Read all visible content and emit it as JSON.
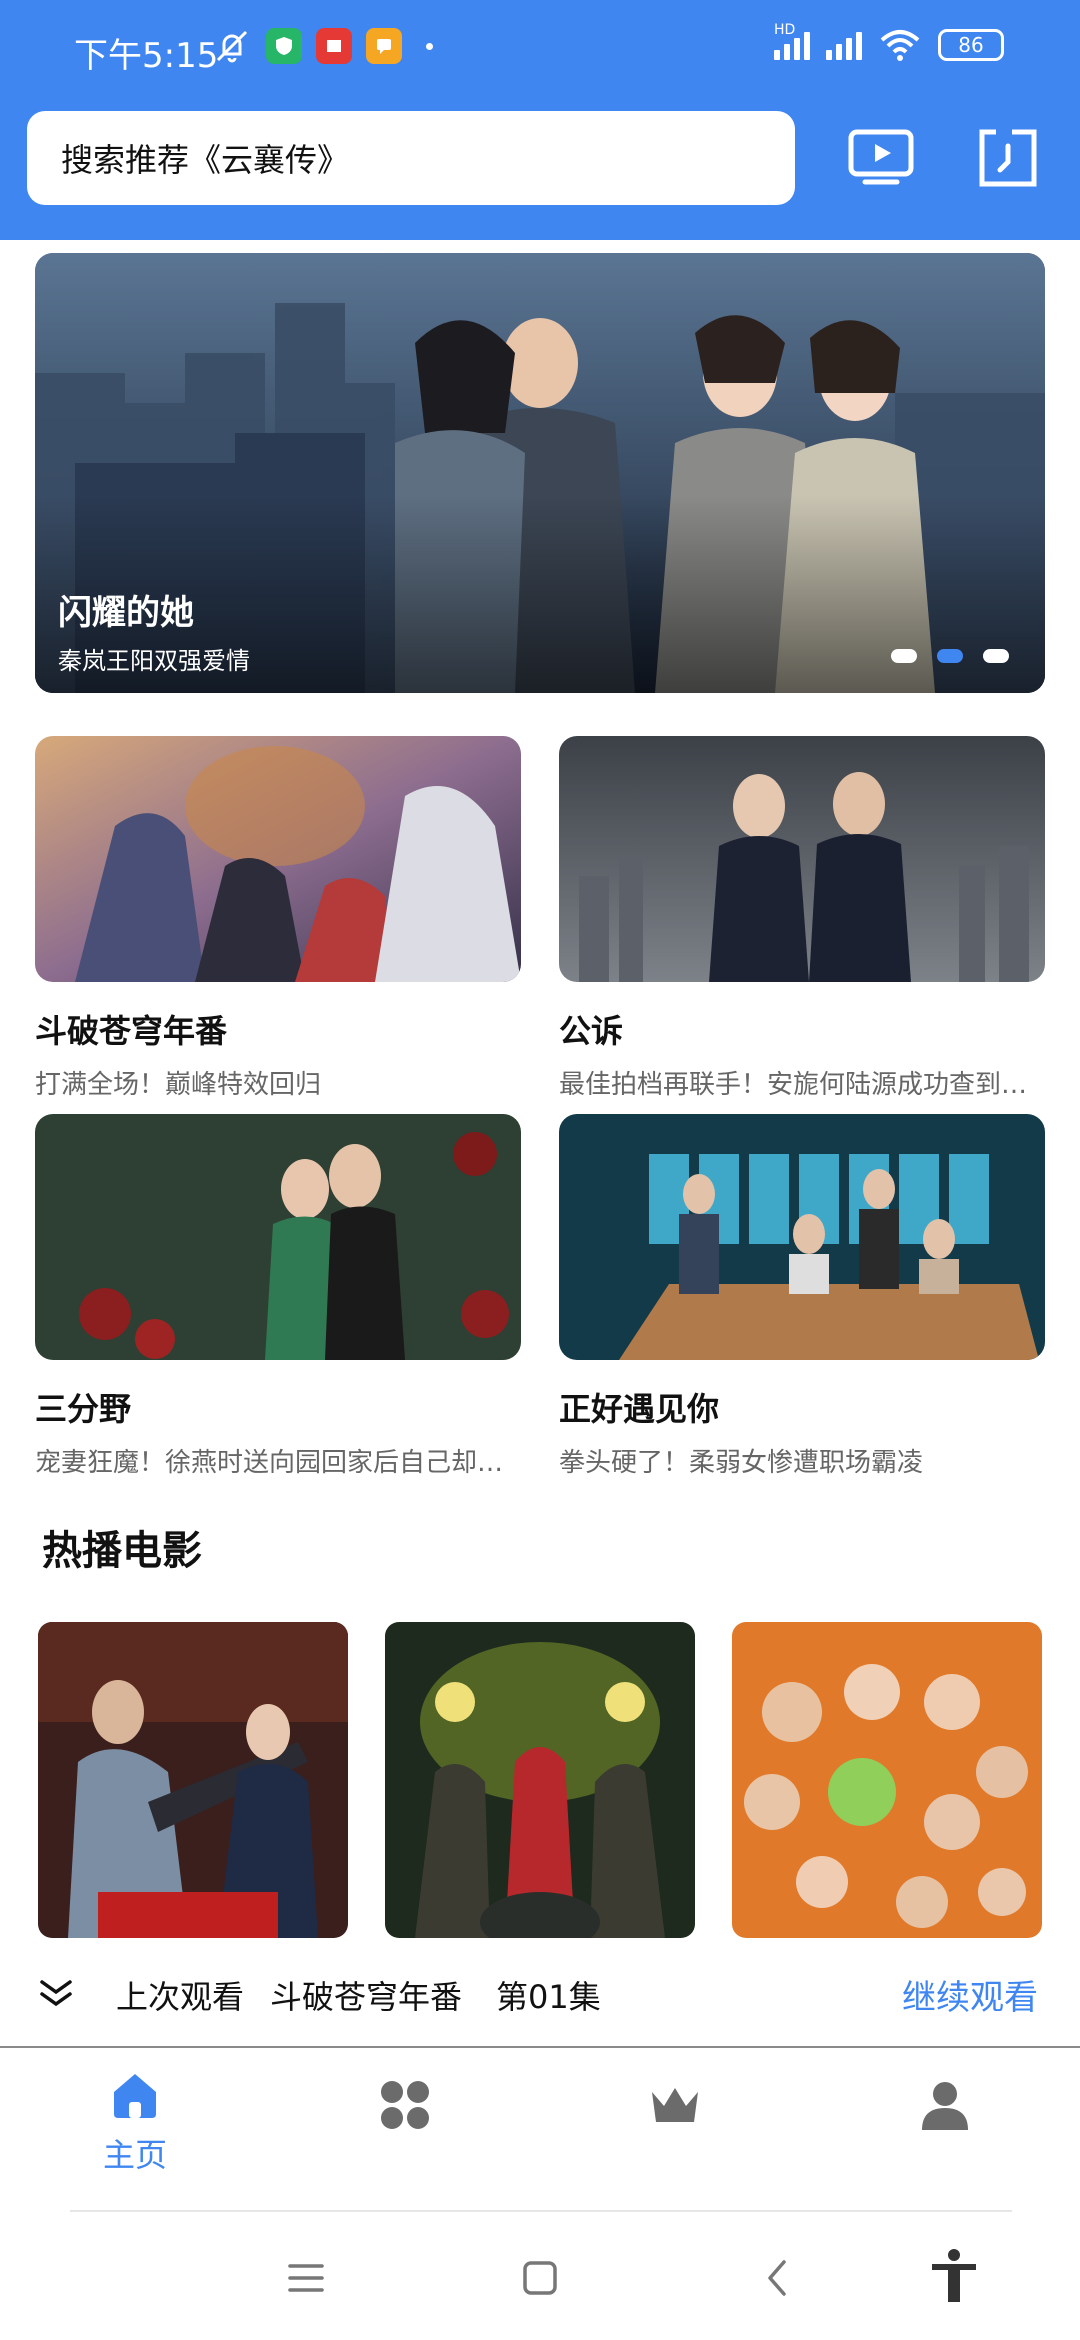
{
  "status": {
    "time": "下午5:15",
    "battery": "86",
    "network_badge": "HD"
  },
  "search": {
    "placeholder": "搜索推荐《云襄传》"
  },
  "banner": {
    "title": "闪耀的她",
    "subtitle": "秦岚王阳双强爱情",
    "dot_count": 3,
    "active_dot": 2
  },
  "cards": [
    {
      "title": "斗破苍穹年番",
      "subtitle": "打满全场！巅峰特效回归"
    },
    {
      "title": "公诉",
      "subtitle": "最佳拍档再联手！安旎何陆源成功查到…"
    },
    {
      "title": "三分野",
      "subtitle": "宠妻狂魔！徐燕时送向园回家后自己却…"
    },
    {
      "title": "正好遇见你",
      "subtitle": "拳头硬了！柔弱女惨遭职场霸凌"
    }
  ],
  "movies_section": {
    "title": "热播电影"
  },
  "continue_watching": {
    "label": "上次观看",
    "show": "斗破苍穹年番",
    "episode": "第01集",
    "button": "继续观看"
  },
  "tabs": {
    "home": "主页"
  },
  "colors": {
    "accent": "#3f86f0",
    "inactive_icon": "#6b6b6b"
  }
}
